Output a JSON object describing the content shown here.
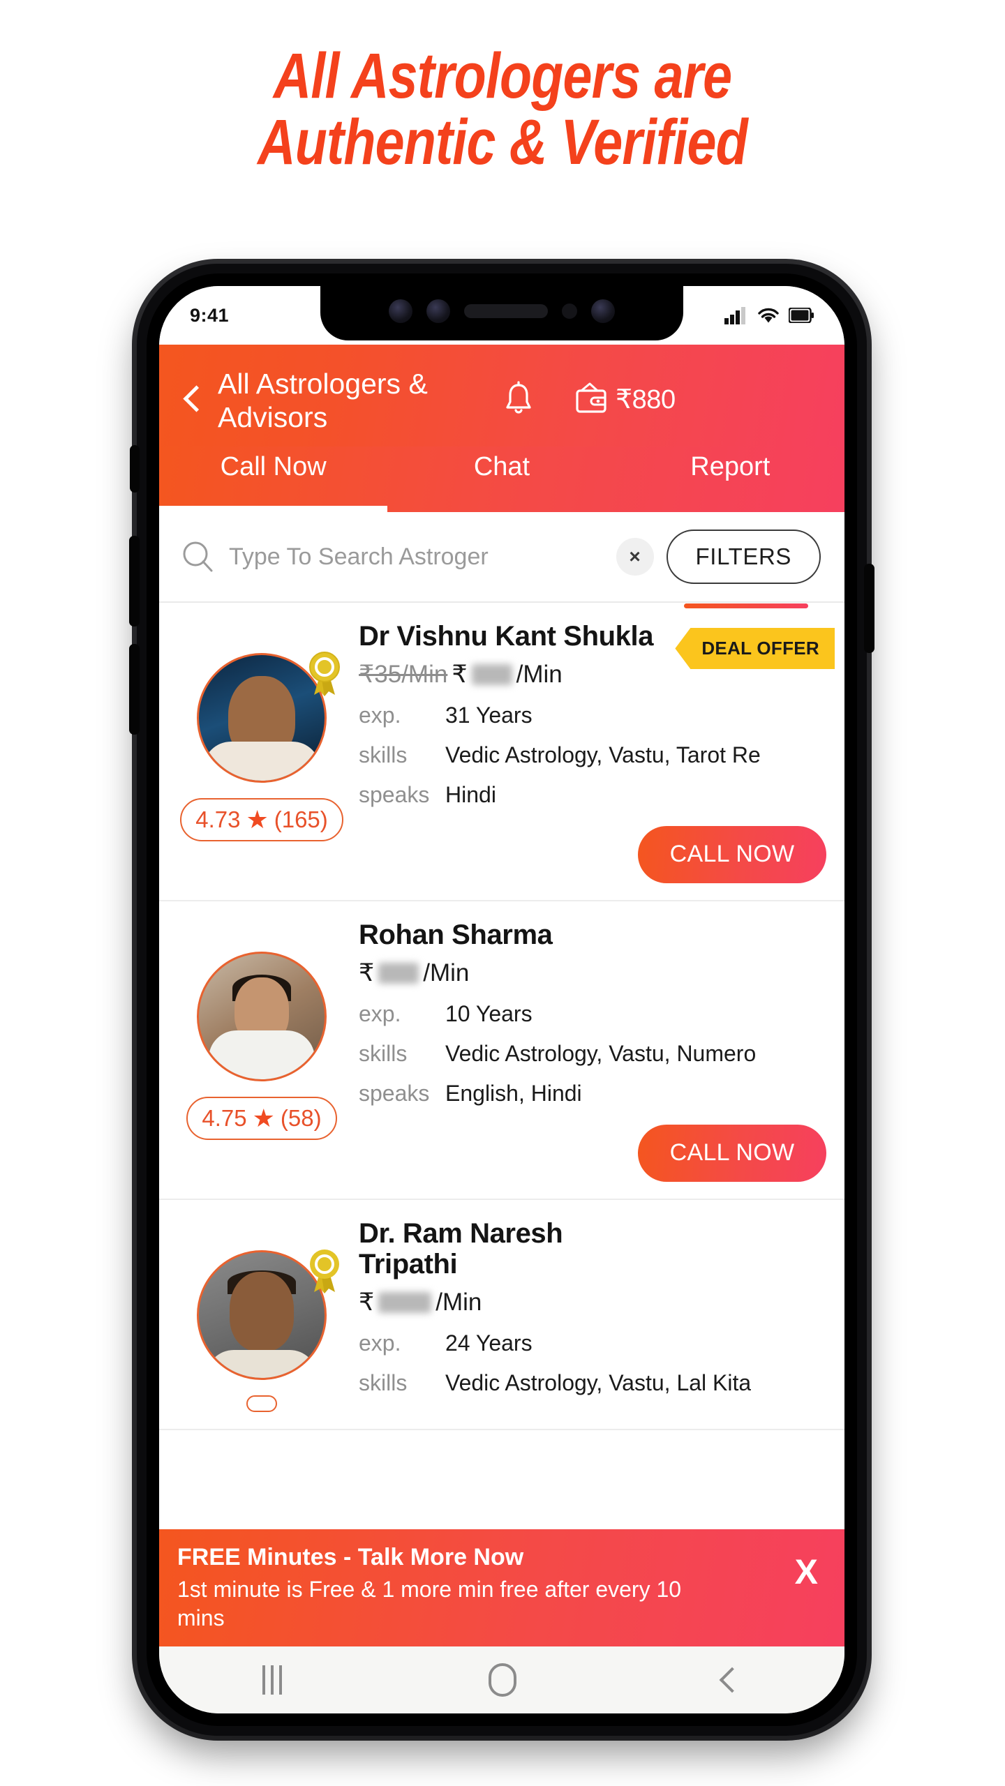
{
  "promo_headline": {
    "line1": "All Astrologers are",
    "line2": "Authentic & Verified",
    "color": "#F4411C"
  },
  "status_bar": {
    "time": "9:41",
    "signal_icon": "signal-bars-icon",
    "wifi_icon": "wifi-icon",
    "battery_icon": "battery-full-icon"
  },
  "header": {
    "back_icon": "back-chevron-icon",
    "title": "All Astrologers & Advisors",
    "bell_icon": "bell-icon",
    "wallet_icon": "wallet-icon",
    "wallet_amount": "₹880",
    "gradient_from": "#F4561F",
    "gradient_to": "#F6405E"
  },
  "tabs": [
    {
      "label": "Call Now",
      "active": true
    },
    {
      "label": "Chat",
      "active": false
    },
    {
      "label": "Report",
      "active": false
    }
  ],
  "search": {
    "search_icon": "search-icon",
    "placeholder": "Type To Search Astroger",
    "value": "",
    "clear_label": "×",
    "filters_label": "FILTERS"
  },
  "labels": {
    "exp": "exp.",
    "skills": "skills",
    "speaks": "speaks",
    "call_now": "CALL NOW",
    "deal_offer": "DEAL OFFER",
    "rupee": "₹",
    "per_min": "/Min"
  },
  "astrologers": [
    {
      "name": "Dr Vishnu Kant Shukla",
      "verified": true,
      "deal_offer": true,
      "price_old": "₹35/Min",
      "price_new_hidden": true,
      "exp": "31 Years",
      "skills": "Vedic Astrology, Vastu, Tarot Re",
      "speaks": "Hindi",
      "rating": "4.73",
      "reviews": "(165)",
      "call_label": "CALL NOW"
    },
    {
      "name": "Rohan Sharma",
      "verified": false,
      "deal_offer": false,
      "price_old": "",
      "price_new_hidden": true,
      "exp": "10 Years",
      "skills": "Vedic Astrology, Vastu, Numero",
      "speaks": "English, Hindi",
      "rating": "4.75",
      "reviews": "(58)",
      "call_label": "CALL NOW"
    },
    {
      "name": "Dr. Ram Naresh Tripathi",
      "verified": true,
      "deal_offer": false,
      "price_old": "",
      "price_new_hidden": true,
      "exp": "24 Years",
      "skills": "Vedic Astrology, Vastu, Lal Kita",
      "speaks": "",
      "rating": "",
      "reviews": "",
      "call_label": ""
    }
  ],
  "promo_banner": {
    "title": "FREE Minutes - Talk More Now",
    "subtitle": "1st  minute is Free & 1 more min free after every 10 mins",
    "close_label": "X"
  },
  "nav_bar": {
    "recents_icon": "recents-icon",
    "home_icon": "home-icon",
    "back_icon": "back-icon"
  }
}
